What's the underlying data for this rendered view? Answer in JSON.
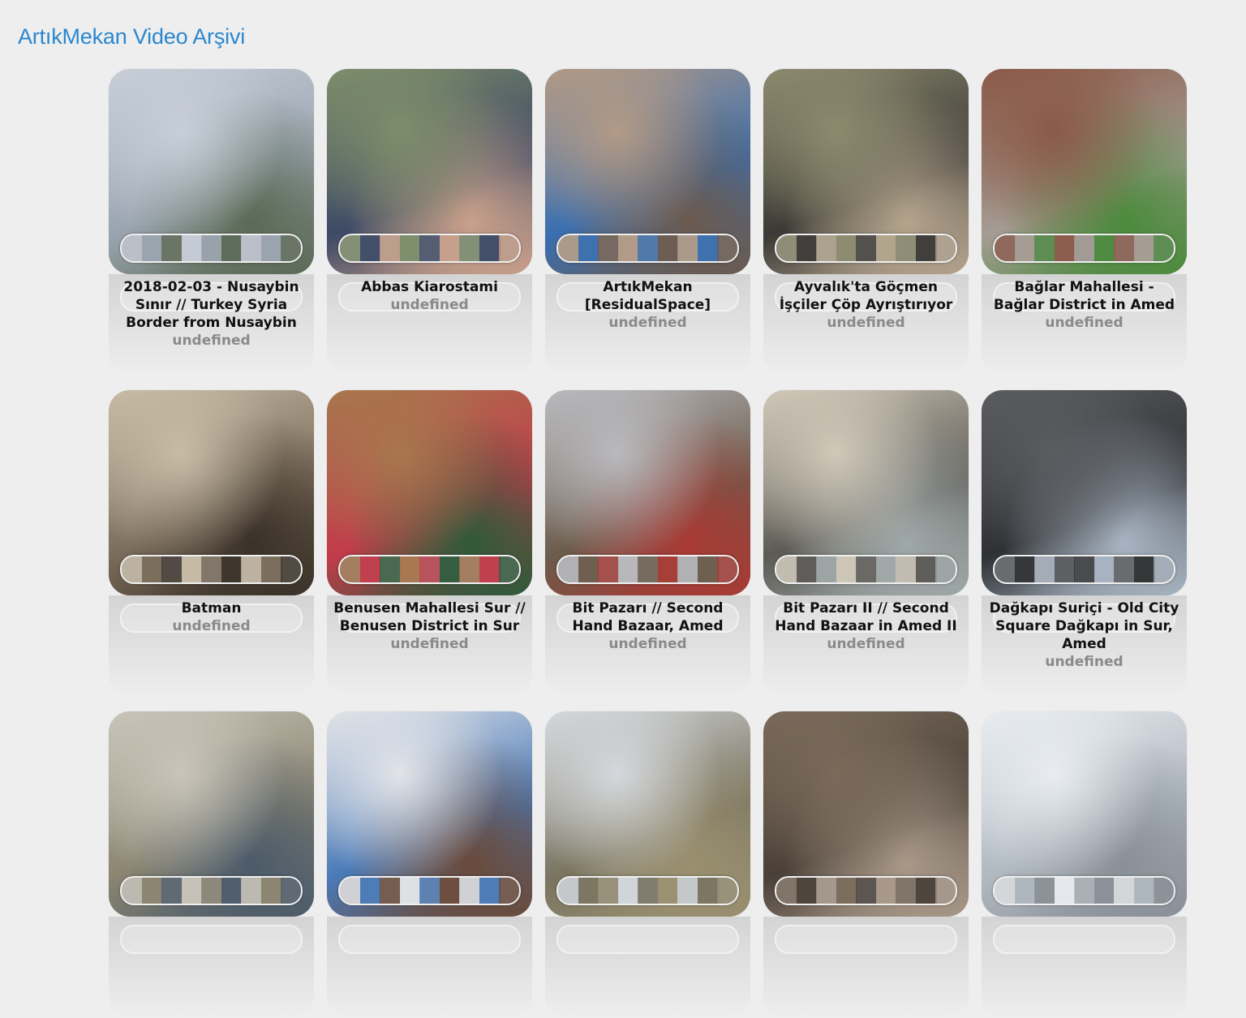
{
  "page": {
    "title": "ArtıkMekan Video Arşivi"
  },
  "videos": [
    {
      "title": "2018-02-03 - Nusaybin Sınır // Turkey Syria Border from Nusaybin",
      "subtitle": "undefined",
      "palette": [
        "#c7ced8",
        "#9aa4b0",
        "#5b6a55"
      ]
    },
    {
      "title": "Abbas Kiarostami",
      "subtitle": "undefined",
      "palette": [
        "#7d8d6a",
        "#3e4a66",
        "#c9a08a"
      ]
    },
    {
      "title": "ArtıkMekan [ResidualSpace]",
      "subtitle": "undefined",
      "palette": [
        "#b29a86",
        "#3a6fb0",
        "#6b5a4f"
      ]
    },
    {
      "title": "Ayvalık'ta Göçmen İşçiler Çöp Ayrıştırıyor",
      "subtitle": "undefined",
      "palette": [
        "#8c8a6e",
        "#3c3a36",
        "#b4a48d"
      ]
    },
    {
      "title": "Bağlar Mahallesi - Bağlar District in Amed",
      "subtitle": "undefined",
      "palette": [
        "#8b5a48",
        "#a59c94",
        "#4b8a3c"
      ]
    },
    {
      "title": "Batman",
      "subtitle": "undefined",
      "palette": [
        "#c8bba6",
        "#7a6c5a",
        "#3a3128"
      ]
    },
    {
      "title": "Benusen Mahallesi Sur // Benusen District in Sur",
      "subtitle": "undefined",
      "palette": [
        "#a8764e",
        "#c33b4a",
        "#2f5a3a"
      ]
    },
    {
      "title": "Bit Pazarı // Second Hand Bazaar, Amed",
      "subtitle": "undefined",
      "palette": [
        "#b9b9bd",
        "#6b5c4c",
        "#a83a34"
      ]
    },
    {
      "title": "Bit Pazarı II // Second Hand Bazaar in Amed II",
      "subtitle": "undefined",
      "palette": [
        "#d0c8b8",
        "#5c5a55",
        "#9fa8a8"
      ]
    },
    {
      "title": "Dağkapı Suriçi - Old City Square Dağkapı in Sur, Amed",
      "subtitle": "undefined",
      "palette": [
        "#5a5c60",
        "#2f3134",
        "#a8b4c2"
      ]
    },
    {
      "title": "",
      "subtitle": "",
      "palette": [
        "#c8c4b8",
        "#8a8470",
        "#4c5b6a"
      ]
    },
    {
      "title": "",
      "subtitle": "",
      "palette": [
        "#e2e4e8",
        "#4a7ab8",
        "#6a4a3a"
      ]
    },
    {
      "title": "",
      "subtitle": "",
      "palette": [
        "#d4d8dc",
        "#7a7460",
        "#9a9070"
      ]
    },
    {
      "title": "",
      "subtitle": "",
      "palette": [
        "#7a6a5a",
        "#4a4038",
        "#a89888"
      ]
    },
    {
      "title": "",
      "subtitle": "",
      "palette": [
        "#e8ecf0",
        "#b0b8c0",
        "#8a9098"
      ]
    }
  ]
}
